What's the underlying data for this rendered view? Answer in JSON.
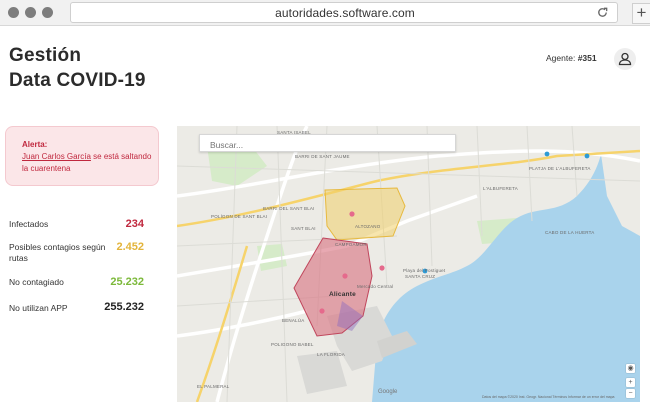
{
  "browser": {
    "url": "autoridades.software.com"
  },
  "header": {
    "title_line1": "Gestión",
    "title_line2": "Data COVID-19",
    "agent_label": "Agente:",
    "agent_id": "#351"
  },
  "alert": {
    "title": "Alerta:",
    "person": "Juan Carlos García",
    "message": "se está saltando la cuarentena"
  },
  "stats": [
    {
      "label": "Infectados",
      "value": "234",
      "color": "#c0283e"
    },
    {
      "label": "Posibles contagios según rutas",
      "value": "2.452",
      "color": "#e3b43a"
    },
    {
      "label": "No contagiado",
      "value": "25.232",
      "color": "#7cb93a"
    },
    {
      "label": "No utilizan APP",
      "value": "255.232",
      "color": "#222222"
    }
  ],
  "map": {
    "search_placeholder": "Buscar...",
    "zoom_in": "+",
    "zoom_out": "−",
    "provider": "Google",
    "footer": "Datos del mapa ©2020 Inst. Geogr. Nacional   Términos   Informar de un error del mapa",
    "area_labels": [
      "SANTA ISABEL",
      "BARRI DE SANT JAUME",
      "L'ALBUFERETA",
      "PLATJA DE L'ALBUFERETA",
      "POLÍGON DE SANT BLAI",
      "BARRI DEL SANT BLAI",
      "SANT BLAI",
      "ALTOZANO",
      "CAMPOAMOR",
      "SANTA CRUZ",
      "BENALÚA",
      "Alicante",
      "POLIGONO BABEL",
      "LA FLORIDA",
      "EL PALMERAL",
      "CABO DE LA HUERTA",
      "Playa del Postiguet",
      "Mercado Central"
    ],
    "zone_colors": {
      "infected": "#d9707e",
      "possible": "#f0cf6a",
      "water": "#9fd0ec",
      "park": "#cde7c3"
    }
  }
}
